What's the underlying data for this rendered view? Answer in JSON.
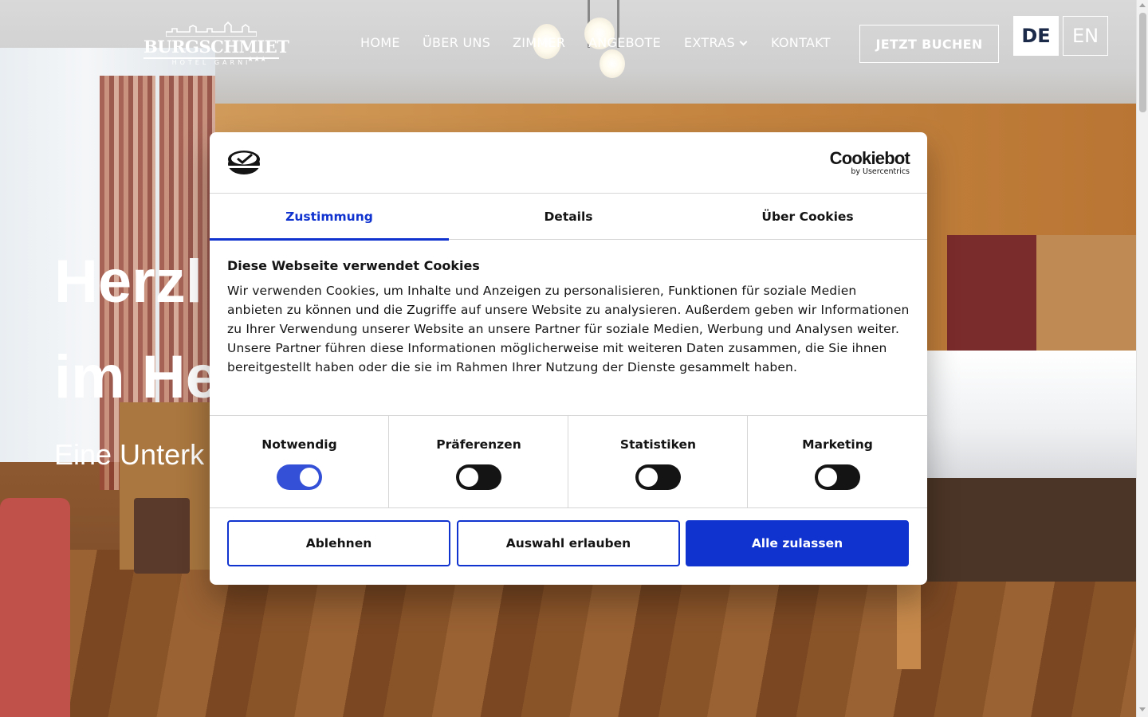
{
  "header": {
    "logo_name": "BURGSCHMIET",
    "logo_subtitle": "HOTEL GARNI",
    "logo_stars": "★★★",
    "nav": [
      {
        "label": "HOME"
      },
      {
        "label": "ÜBER UNS"
      },
      {
        "label": "ZIMMER"
      },
      {
        "label": "ANGEBOTE"
      },
      {
        "label": "EXTRAS"
      },
      {
        "label": "KONTAKT"
      }
    ],
    "book_button": "JETZT BUCHEN",
    "languages": [
      "DE",
      "EN"
    ],
    "active_language": "DE"
  },
  "hero": {
    "line1_visible": "Herzl",
    "line2_visible": "im He",
    "subtitle_visible": "Eine Unterk"
  },
  "cookie_dialog": {
    "brand": "Cookiebot",
    "brand_sub": "by Usercentrics",
    "tabs": [
      {
        "label": "Zustimmung",
        "active": true
      },
      {
        "label": "Details",
        "active": false
      },
      {
        "label": "Über Cookies",
        "active": false
      }
    ],
    "title": "Diese Webseite verwendet Cookies",
    "text": "Wir verwenden Cookies, um Inhalte und Anzeigen zu personalisieren, Funktionen für soziale Medien anbieten zu können und die Zugriffe auf unsere Website zu analysieren. Außerdem geben wir Informationen zu Ihrer Verwendung unserer Website an unsere Partner für soziale Medien, Werbung und Analysen weiter. Unsere Partner führen diese Informationen möglicherweise mit weiteren Daten zusammen, die Sie ihnen bereitgestellt haben oder die sie im Rahmen Ihrer Nutzung der Dienste gesammelt haben.",
    "categories": [
      {
        "label": "Notwendig",
        "checked": true
      },
      {
        "label": "Präferenzen",
        "checked": false
      },
      {
        "label": "Statistiken",
        "checked": false
      },
      {
        "label": "Marketing",
        "checked": false
      }
    ],
    "buttons": {
      "decline": "Ablehnen",
      "allow_selection": "Auswahl erlauben",
      "allow_all": "Alle zulassen"
    }
  },
  "colors": {
    "accent": "#1032cf",
    "text": "#141414",
    "lang_active_text": "#1b2a49"
  }
}
